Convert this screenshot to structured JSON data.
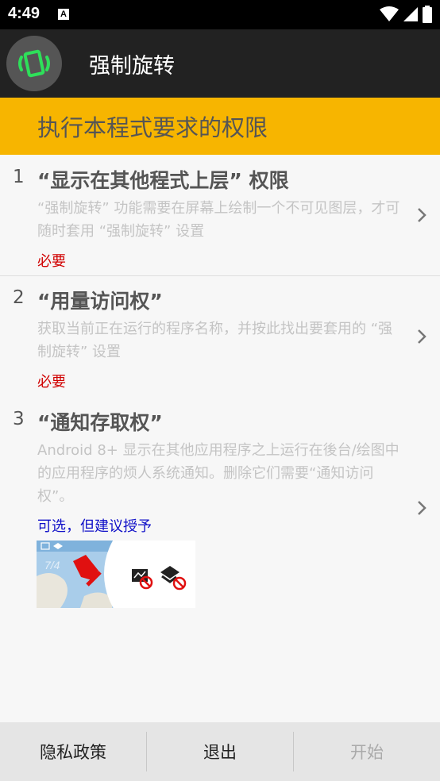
{
  "status_bar": {
    "time": "4:49",
    "notification_glyph": "A",
    "icons": [
      "wifi-icon",
      "signal-icon",
      "battery-icon"
    ]
  },
  "app_bar": {
    "title": "强制旋转",
    "logo_icon": "rotate-phone-icon"
  },
  "banner": {
    "text": "执行本程式要求的权限",
    "color": "#f7b500"
  },
  "permissions": [
    {
      "number": "1",
      "title": "“显示在其他程式上层” 权限",
      "description": "“强制旋转” 功能需要在屏幕上绘制一个不可见图层，才可随时套用 “强制旋转” 设置",
      "requirement": "必要",
      "requirement_color": "#d00000"
    },
    {
      "number": "2",
      "title": "“用量访问权”",
      "description": "获取当前正在运行的程序名称，并按此找出要套用的 “强制旋转” 设置",
      "requirement": "必要",
      "requirement_color": "#d00000"
    },
    {
      "number": "3",
      "title": "“通知存取权”",
      "description": "Android 8+ 显示在其他应用程序之上运行在後台/绘图中的应用程序的烦人系统通知。删除它们需要“通知访问权”。",
      "requirement": "可选，但建议授予",
      "requirement_color": "#1010c8",
      "preview_date": "7/4"
    }
  ],
  "bottom_bar": {
    "privacy_label": "隐私政策",
    "exit_label": "退出",
    "start_label": "开始"
  }
}
